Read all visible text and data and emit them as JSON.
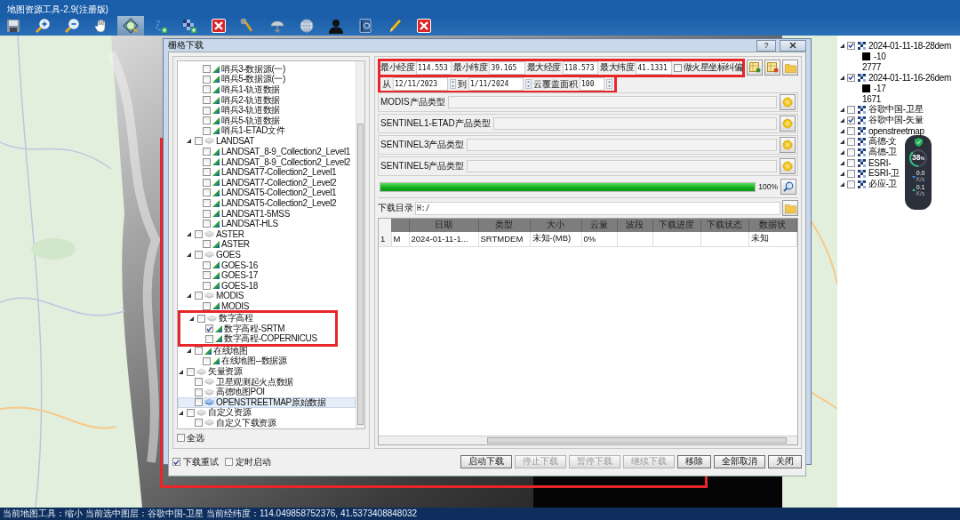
{
  "window": {
    "title": "地图资源工具-2.9(注册版)"
  },
  "toolbar": [
    {
      "kind": "save",
      "selected": false
    },
    {
      "kind": "zoom-in",
      "selected": false
    },
    {
      "kind": "zoom-out",
      "selected": false
    },
    {
      "kind": "pan",
      "selected": false
    },
    {
      "kind": "locate",
      "selected": true
    },
    {
      "kind": "polyline",
      "selected": false
    },
    {
      "kind": "raster-add",
      "selected": false
    },
    {
      "kind": "delete",
      "selected": false
    },
    {
      "kind": "tools",
      "selected": false
    },
    {
      "kind": "download",
      "selected": false
    },
    {
      "kind": "globe",
      "selected": false
    },
    {
      "kind": "user",
      "selected": false
    },
    {
      "kind": "help",
      "selected": false
    },
    {
      "kind": "edit",
      "selected": false
    },
    {
      "kind": "close",
      "selected": false
    }
  ],
  "map": {
    "kind": "picture",
    "highlighted": true
  },
  "dialog": {
    "title": "栅格下载",
    "help": "?",
    "tree": [
      {
        "children": [
          {
            "children": [
              {
                "label": "哨兵3-数据源(一)",
                "kind": "raster",
                "checked": false,
                "selected": false
              },
              {
                "label": "哨兵5-数据源(一)",
                "kind": "raster",
                "checked": false,
                "selected": false
              },
              {
                "label": "哨兵1-轨道数据",
                "kind": "raster",
                "checked": false,
                "selected": false
              },
              {
                "label": "哨兵2-轨道数据",
                "kind": "raster",
                "checked": false,
                "selected": false
              },
              {
                "label": "哨兵3-轨道数据",
                "kind": "raster",
                "checked": false,
                "selected": false
              },
              {
                "label": "哨兵5-轨道数据",
                "kind": "raster",
                "checked": false,
                "selected": false
              },
              {
                "label": "哨兵1-ETAD文件",
                "kind": "raster",
                "checked": false,
                "selected": false
              }
            ]
          },
          {
            "label": "LANDSAT",
            "kind": "layers",
            "checked": false,
            "selected": false,
            "expanded": true,
            "children": [
              {
                "label": "LANDSAT_8-9_Collection2_Level1",
                "kind": "raster",
                "checked": false,
                "selected": false
              },
              {
                "label": "LANDSAT_8-9_Collection2_Level2",
                "kind": "raster",
                "checked": false,
                "selected": false
              },
              {
                "label": "LANDSAT7-Collection2_Level1",
                "kind": "raster",
                "checked": false,
                "selected": false
              },
              {
                "label": "LANDSAT7-Collection2_Level2",
                "kind": "raster",
                "checked": false,
                "selected": false
              },
              {
                "label": "LANDSAT5-Collection2_Level1",
                "kind": "raster",
                "checked": false,
                "selected": false
              },
              {
                "label": "LANDSAT5-Collection2_Level2",
                "kind": "raster",
                "checked": false,
                "selected": false
              },
              {
                "label": "LANDSAT1-5MSS",
                "kind": "raster",
                "checked": false,
                "selected": false
              },
              {
                "label": "LANDSAT-HLS",
                "kind": "raster",
                "checked": false,
                "selected": false
              }
            ]
          },
          {
            "label": "ASTER",
            "kind": "layers",
            "checked": false,
            "selected": false,
            "expanded": true,
            "children": [
              {
                "label": "ASTER",
                "kind": "raster",
                "checked": false,
                "selected": false
              }
            ]
          },
          {
            "label": "GOES",
            "kind": "layers",
            "checked": false,
            "selected": false,
            "expanded": true,
            "children": [
              {
                "label": "GOES-16",
                "kind": "raster",
                "checked": false,
                "selected": false
              },
              {
                "label": "GOES-17",
                "kind": "raster",
                "checked": false,
                "selected": false
              },
              {
                "label": "GOES-18",
                "kind": "raster",
                "checked": false,
                "selected": false
              }
            ]
          },
          {
            "label": "MODIS",
            "kind": "layers",
            "checked": false,
            "selected": false,
            "expanded": true,
            "children": [
              {
                "label": "MODIS",
                "kind": "raster",
                "checked": false,
                "selected": false
              }
            ]
          },
          {
            "label": "数字高程",
            "kind": "layers",
            "checked": false,
            "selected": false,
            "expanded": true,
            "highlighted": true,
            "children": [
              {
                "label": "数字高程-SRTM",
                "kind": "raster",
                "checked": true,
                "selected": false
              },
              {
                "label": "数字高程-COPERNICUS",
                "kind": "raster",
                "checked": false,
                "selected": false
              }
            ]
          },
          {
            "label": "在线地图",
            "kind": "raster",
            "checked": false,
            "selected": false,
            "expanded": true,
            "children": [
              {
                "label": "在线地图--数据源",
                "kind": "raster",
                "checked": false,
                "selected": false
              }
            ]
          }
        ]
      },
      {
        "label": "矢量资源",
        "kind": "layers",
        "checked": false,
        "selected": false,
        "expanded": true,
        "children": [
          {
            "label": "卫星观测起火点数据",
            "kind": "layers",
            "checked": false,
            "selected": false
          },
          {
            "label": "高德地图POI",
            "kind": "layers",
            "checked": false,
            "selected": false
          },
          {
            "label": "OPENSTREETMAP原始数据",
            "kind": "layers-blue",
            "checked": false,
            "selected": true
          }
        ]
      },
      {
        "label": "自定义资源",
        "kind": "layers",
        "checked": false,
        "selected": false,
        "expanded": true,
        "children": [
          {
            "label": "自定义下载资源",
            "kind": "layers",
            "checked": false,
            "selected": false
          }
        ]
      }
    ],
    "select_all": {
      "label": "全选",
      "checked": false
    },
    "coordinates": {
      "highlighted": true,
      "fields": [
        {
          "label": "最小经度",
          "value": "114.553"
        },
        {
          "label": "最小纬度",
          "value": "39.165"
        },
        {
          "label": "最大经度",
          "value": "118.573"
        },
        {
          "label": "最大纬度",
          "value": "41.1331"
        }
      ],
      "mars_fix": {
        "label": "做火星坐标纠偏",
        "checked": false
      }
    },
    "coord_buttons": [
      {
        "kind": "import"
      },
      {
        "kind": "export"
      },
      {
        "kind": "folder"
      }
    ],
    "date_filter": {
      "highlighted": true,
      "from_label": "从",
      "from": "12/11/2023",
      "to_label": "到",
      "to": "1/11/2024",
      "cloud_label": "云覆盖面积",
      "cloud": "100"
    },
    "product_types": [
      {
        "label": "MODIS产品类型"
      },
      {
        "label": "SENTINEL1-ETAD产品类型"
      },
      {
        "label": "SENTINEL3产品类型"
      },
      {
        "label": "SENTINEL5产品类型"
      }
    ],
    "progress": {
      "level": 1,
      "reading": "100%"
    },
    "download_dir": {
      "label": "下载目录",
      "value": "H:/"
    },
    "table": {
      "columns": [
        "日期",
        "类型",
        "大小",
        "云量",
        "波段",
        "下载进度",
        "下载状态",
        "数据状"
      ],
      "rows": [
        {
          "number": "1",
          "mark": "M",
          "cells": [
            "2024-01-11-1...",
            "SRTMDEM",
            "未知-(MB)",
            "0%",
            null,
            null,
            null,
            "未知"
          ]
        }
      ]
    },
    "options": [
      {
        "label": "下载重试",
        "checked": true
      },
      {
        "label": "定时启动",
        "checked": false
      }
    ],
    "buttons": [
      {
        "label": "启动下载",
        "disabled": false
      },
      {
        "label": "停止下载",
        "disabled": true
      },
      {
        "label": "暂停下载",
        "disabled": true
      },
      {
        "label": "继续下载",
        "disabled": true
      },
      {
        "label": "移除",
        "disabled": false
      },
      {
        "label": "全部取消",
        "disabled": false
      },
      {
        "label": "关闭",
        "disabled": false
      }
    ]
  },
  "layers": [
    {
      "label": "2024-01-11-18-28dem",
      "checked": true,
      "legend": {
        "low": "-10",
        "high": "2777"
      }
    },
    {
      "label": "2024-01-11-16-26dem",
      "checked": true,
      "legend": {
        "low": "-17",
        "high": "1671"
      }
    },
    {
      "label": "谷歌中国-卫星",
      "checked": false
    },
    {
      "label": "谷歌中国-矢量",
      "checked": true
    },
    {
      "label": "openstreetmap",
      "checked": false
    },
    {
      "label": "高德-文",
      "checked": false
    },
    {
      "label": "高德-卫",
      "checked": false
    },
    {
      "label": "ESRI-",
      "checked": false
    },
    {
      "label": "ESRI-卫",
      "checked": false
    },
    {
      "label": "必应-卫",
      "checked": false
    }
  ],
  "net_widget": {
    "percent": "38",
    "unit": "%",
    "down": "0.0",
    "down_unit": "K/s",
    "up": "0.1",
    "up_unit": "K/s"
  },
  "status_bar": "当前地图工具：缩小  当前选中图层：谷歌中国-卫星  当前经纬度：114.049858752376, 41.5373408848032"
}
